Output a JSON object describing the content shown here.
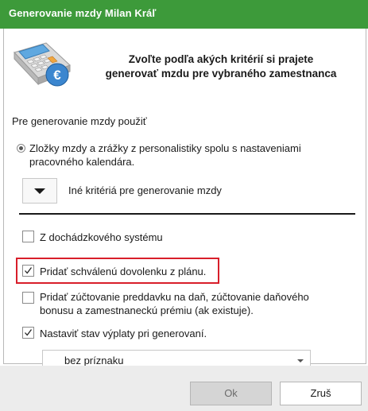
{
  "window": {
    "title": "Generovanie mzdy Milan Kráľ"
  },
  "header": {
    "icon": "calculator-euro-icon",
    "line1": "Zvoľte podľa akých kritérií si prajete",
    "line2": "generovať mzdu pre vybraného zamestnanca"
  },
  "section_label": "Pre generovanie mzdy použiť",
  "radio_option": {
    "line1": "Zložky mzdy a zrážky z personalistiky spolu s nastaveniami",
    "line2": "pracovného kalendára.",
    "selected": true
  },
  "expander": {
    "label": "Iné kritériá pre generovanie mzdy",
    "icon": "chevron-down-icon"
  },
  "options": [
    {
      "line1": "Z dochádzkového systému",
      "checked": false
    },
    {
      "line1": "Pridať schválenú dovolenku z plánu.",
      "checked": true
    },
    {
      "line1": "Pridať zúčtovanie preddavku na daň, zúčtovanie daňového",
      "line2": "bonusu a zamestnaneckú prémiu (ak existuje).",
      "checked": false
    },
    {
      "line1": "Nastaviť stav výplaty pri generovaní.",
      "checked": true
    }
  ],
  "status_select": {
    "value": "bez príznaku"
  },
  "buttons": {
    "ok": "Ok",
    "cancel": "Zruš"
  },
  "colors": {
    "titlebar": "#3d9a3a",
    "highlight_border": "#d81e2a"
  }
}
